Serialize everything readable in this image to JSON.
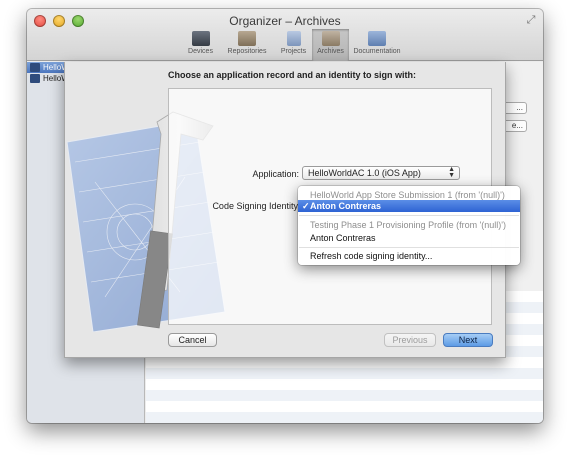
{
  "window": {
    "title": "Organizer – Archives"
  },
  "toolbar": {
    "items": [
      {
        "label": "Devices",
        "icon": "devices-icon"
      },
      {
        "label": "Repositories",
        "icon": "repositories-icon"
      },
      {
        "label": "Projects",
        "icon": "projects-icon"
      },
      {
        "label": "Archives",
        "icon": "archives-icon",
        "selected": true
      },
      {
        "label": "Documentation",
        "icon": "documentation-icon"
      }
    ]
  },
  "sidebar": {
    "items": [
      {
        "label": "HelloW",
        "selected": true
      },
      {
        "label": "HelloWorld",
        "selected": false
      }
    ]
  },
  "background_buttons": {
    "first": "...",
    "second": "e..."
  },
  "sheet": {
    "heading": "Choose an application record and an identity to sign with:",
    "application_label": "Application:",
    "application_value": "HelloWorldAC 1.0 (iOS App)",
    "identity_label": "Code Signing Identity",
    "cancel": "Cancel",
    "previous": "Previous",
    "next": "Next"
  },
  "menu": {
    "group1_header": "HelloWorld App Store Submission 1 (from '(null)')",
    "group1_item": "Anton Contreras",
    "checkmark": "✓",
    "group2_header": "Testing Phase 1 Provisioning Profile (from '(null)')",
    "group2_item": "Anton Contreras",
    "refresh": "Refresh code signing identity..."
  },
  "colors": {
    "accent": "#2e63d3",
    "next_button": "#5d9be5",
    "blueprint": "#6f97d6"
  }
}
